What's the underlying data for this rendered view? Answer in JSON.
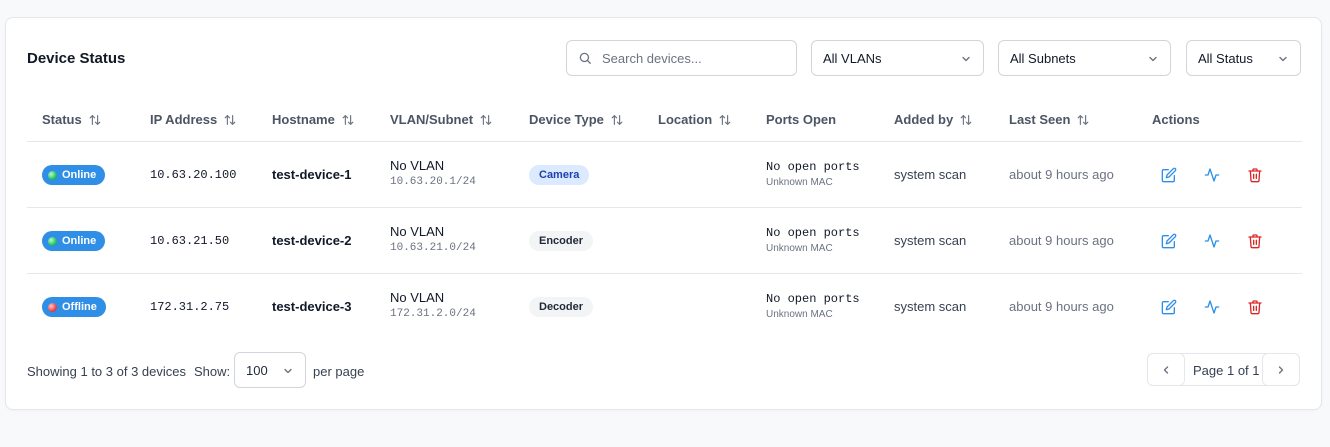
{
  "title": "Device Status",
  "search": {
    "placeholder": "Search devices...",
    "value": ""
  },
  "filters": {
    "vlan": "All VLANs",
    "subnet": "All Subnets",
    "status": "All Status"
  },
  "columns": [
    "Status",
    "IP Address",
    "Hostname",
    "VLAN/Subnet",
    "Device Type",
    "Location",
    "Ports Open",
    "Added by",
    "Last Seen",
    "Actions"
  ],
  "rows": [
    {
      "status": "Online",
      "ip": "10.63.20.100",
      "hostname": "test-device-1",
      "vlan": "No VLAN",
      "subnet": "10.63.20.1/24",
      "type": "Camera",
      "location": "",
      "ports": "No open ports",
      "mac": "Unknown MAC",
      "added_by": "system scan",
      "last_seen": "about 9 hours ago"
    },
    {
      "status": "Online",
      "ip": "10.63.21.50",
      "hostname": "test-device-2",
      "vlan": "No VLAN",
      "subnet": "10.63.21.0/24",
      "type": "Encoder",
      "location": "",
      "ports": "No open ports",
      "mac": "Unknown MAC",
      "added_by": "system scan",
      "last_seen": "about 9 hours ago"
    },
    {
      "status": "Offline",
      "ip": "172.31.2.75",
      "hostname": "test-device-3",
      "vlan": "No VLAN",
      "subnet": "172.31.2.0/24",
      "type": "Decoder",
      "location": "",
      "ports": "No open ports",
      "mac": "Unknown MAC",
      "added_by": "system scan",
      "last_seen": "about 9 hours ago"
    }
  ],
  "footer": {
    "showing": "Showing 1 to 3 of 3 devices",
    "show_label": "Show:",
    "per_page_value": "100",
    "per_page_label": "per page",
    "page_text": "Page 1 of 1"
  },
  "colors": {
    "status_badge": "#2f8fe6",
    "online_dot": "#22c55e",
    "offline_dot": "#ef4444",
    "edit_icon": "#2f8fe6",
    "activity_icon": "#2f8fe6",
    "delete_icon": "#dc2626",
    "camera_badge_bg": "#dbeafe",
    "camera_badge_fg": "#1e40af",
    "neutral_badge_bg": "#f3f4f6"
  },
  "icons": {
    "search": "search-icon",
    "sort": "sort-arrows-icon",
    "edit": "edit-icon",
    "activity": "activity-icon",
    "delete": "trash-icon",
    "chevron": "chevron-down-icon"
  }
}
